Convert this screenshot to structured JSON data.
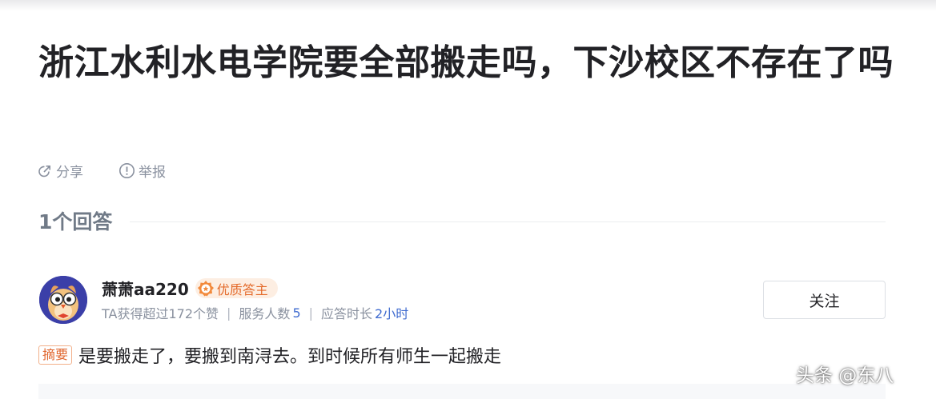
{
  "question": {
    "title": "浙江水利水电学院要全部搬走吗，下沙校区不存在了吗"
  },
  "actions": {
    "share_label": "分享",
    "report_label": "举报"
  },
  "answers": {
    "count_label": "1个回答"
  },
  "answer": {
    "author": {
      "name": "萧萧aa220",
      "badge_label": "优质答主"
    },
    "stats": {
      "likes_text": "TA获得超过172个赞",
      "separator": "|",
      "served_label": "服务人数",
      "served_value": "5",
      "response_label": "应答时长",
      "response_value": "2小时"
    },
    "follow_label": "关注",
    "summary_tag": "摘要",
    "summary_text": "是要搬走了，要搬到南浔去。到时候所有师生一起搬走"
  },
  "watermark": "头条 @东八",
  "colors": {
    "accent_blue": "#406cd0",
    "badge_orange": "#e46a2a",
    "text_dark": "#222226",
    "text_gray": "#8a919f"
  }
}
